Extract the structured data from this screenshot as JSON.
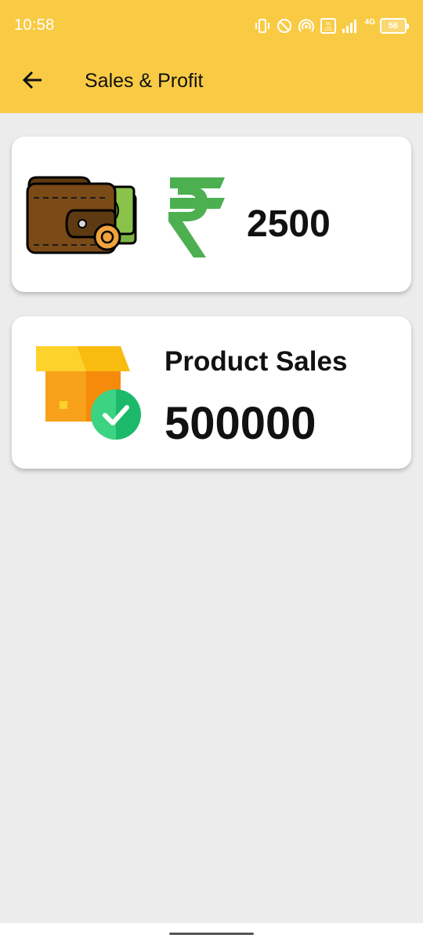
{
  "status_bar": {
    "time": "10:58",
    "network": "4G",
    "battery_level": "56",
    "icons": [
      "vibrate-icon",
      "do-not-disturb-icon",
      "hotspot-icon",
      "volte-icon",
      "signal-icon",
      "battery-icon"
    ]
  },
  "app_bar": {
    "title": "Sales & Profit",
    "back_icon": "arrow-back-icon",
    "background_color": "#f9cb45"
  },
  "profit_card": {
    "icon": "wallet-icon",
    "currency_icon": "rupee-icon",
    "value": "2500"
  },
  "sales_card": {
    "icon": "box-check-icon",
    "label": "Product Sales",
    "value": "500000"
  },
  "colors": {
    "accent": "#f9cb45",
    "rupee_green": "#4caf50",
    "background": "#ececec"
  }
}
